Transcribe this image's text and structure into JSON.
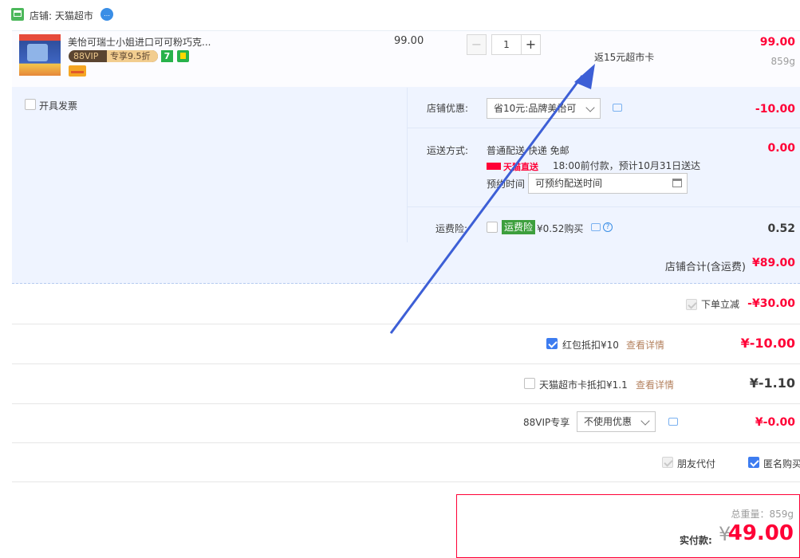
{
  "shop": {
    "label": "店铺: 天猫超市"
  },
  "item": {
    "title": "美怡可瑞士小姐进口可可粉巧克...",
    "vip_label": "88VIP",
    "vip_discount": "专享9.5折",
    "seven_badge": "7",
    "unit_price": "99.00",
    "quantity": "1",
    "minus": "−",
    "plus": "+",
    "rebate": "返15元超市卡",
    "total": "99.00",
    "weight": "859g"
  },
  "invoice": {
    "label": "开具发票"
  },
  "shop_discount": {
    "label": "店铺优惠:",
    "selected": "省10元:品牌美怡可",
    "amount": "-10.00"
  },
  "delivery": {
    "label": "运送方式:",
    "method": "普通配送 快递 免邮",
    "tmall_direct": "天猫直送",
    "eta": "18:00前付款，预计10月31日送达",
    "reserve_label": "预约时间",
    "reserve_placeholder": "可预约配送时间",
    "amount": "0.00"
  },
  "shipping_insurance": {
    "label": "运费险:",
    "tag": "运费险",
    "price": "¥0.52购买",
    "help": "?",
    "amount": "0.52"
  },
  "shop_subtotal": {
    "label": "店铺合计(含运费)",
    "amount": "¥89.00"
  },
  "order_discount": {
    "label": "下单立减",
    "amount": "-¥30.00"
  },
  "red_packet": {
    "label": "红包抵扣¥10",
    "link": "查看详情",
    "amount": "¥-10.00"
  },
  "supermarket_card": {
    "label": "天猫超市卡抵扣¥1.1",
    "link": "查看详情",
    "amount": "¥-1.10"
  },
  "vip88": {
    "label": "88VIP专享",
    "selected": "不使用优惠",
    "amount": "¥-0.00"
  },
  "friend_pay": {
    "label": "朋友代付"
  },
  "anonymous": {
    "label": "匿名购买"
  },
  "payment": {
    "weight_label": "总重量：859g",
    "actual_label": "实付款:",
    "currency": "¥",
    "amount": "49.00"
  },
  "colors": {
    "accent": "#ff0036",
    "checkbox": "#3d7cf0",
    "panel": "#eff4ff",
    "arrow": "#3d5fd6"
  }
}
